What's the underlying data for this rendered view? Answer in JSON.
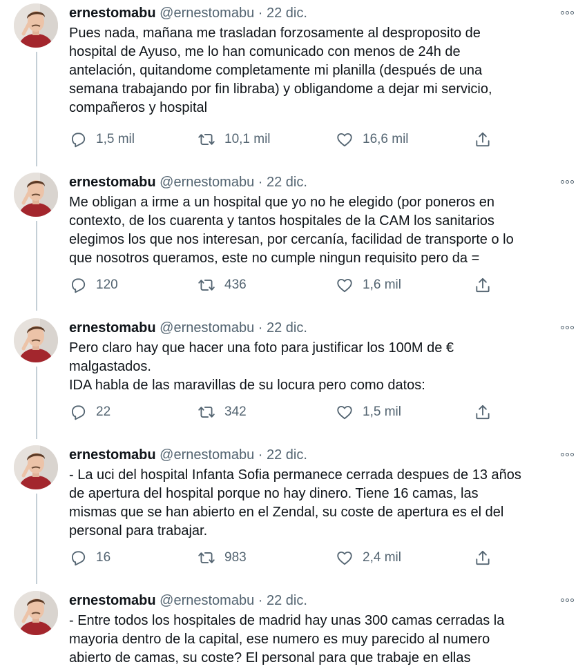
{
  "tweets": [
    {
      "name": "ernestomabu",
      "handle": "@ernestomabu",
      "dot": "·",
      "date": "22 dic.",
      "text": "Pues nada, mañana me trasladan forzosamente al desproposito de\nhospital de Ayuso, me lo han comunicado con menos de 24h de\nantelación, quitandome completamente mi planilla (después de una\nsemana trabajando por fin libraba) y obligandome a dejar mi servicio,\ncompañeros y hospital",
      "replies": "1,5 mil",
      "retweets": "10,1 mil",
      "likes": "16,6 mil"
    },
    {
      "name": "ernestomabu",
      "handle": "@ernestomabu",
      "dot": "·",
      "date": "22 dic.",
      "text": "Me obligan a irme a un hospital que yo no he elegido (por poneros en\ncontexto, de los cuarenta y tantos hospitales de la CAM los sanitarios\nelegimos los que nos interesan, por cercanía, facilidad de transporte o lo\nque nosotros queramos, este no cumple ningun requisito pero da =",
      "replies": "120",
      "retweets": "436",
      "likes": "1,6 mil"
    },
    {
      "name": "ernestomabu",
      "handle": "@ernestomabu",
      "dot": "·",
      "date": "22 dic.",
      "text": "Pero claro hay que hacer una foto para justificar los 100M de €\nmalgastados.\nIDA habla de las maravillas de su locura pero como datos:",
      "replies": "22",
      "retweets": "342",
      "likes": "1,5 mil"
    },
    {
      "name": "ernestomabu",
      "handle": "@ernestomabu",
      "dot": "·",
      "date": "22 dic.",
      "text": "- La uci del hospital Infanta Sofia permanece cerrada despues de 13 años\nde apertura del hospital porque no hay dinero. Tiene 16 camas, las\nmismas que se han abierto en el Zendal, su coste de apertura es el del\npersonal para trabajar.",
      "replies": "16",
      "retweets": "983",
      "likes": "2,4 mil"
    },
    {
      "name": "ernestomabu",
      "handle": "@ernestomabu",
      "dot": "·",
      "date": "22 dic.",
      "text": "- Entre todos los hospitales de madrid hay unas 300 camas cerradas la\nmayoria dentro de la capital, ese numero es muy parecido al numero\nabierto de camas, su coste? El personal para que trabaje en ellas"
    }
  ],
  "icons": {
    "reply": "reply-icon",
    "retweet": "retweet-icon",
    "like": "heart-icon",
    "share": "share-icon",
    "more": "more-icon"
  },
  "colors": {
    "text": "#0f1419",
    "secondary": "#536471",
    "thread_line": "#c4cfd6"
  }
}
